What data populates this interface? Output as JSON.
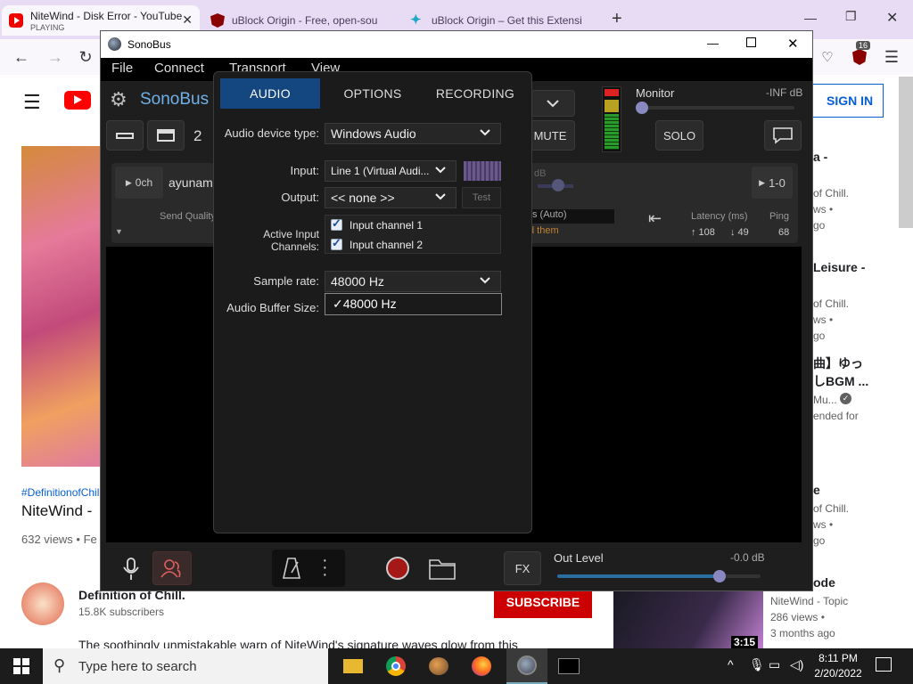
{
  "browser": {
    "tabs": [
      {
        "title": "NiteWind - Disk Error - YouTube",
        "subtitle": "PLAYING",
        "icon": "youtube-icon"
      },
      {
        "title": "uBlock Origin - Free, open-sou",
        "icon": "ublock-icon"
      },
      {
        "title": "uBlock Origin – Get this Extensi",
        "icon": "mozilla-addons-icon"
      }
    ],
    "new_tab": "+",
    "extension_badge": "16"
  },
  "youtube": {
    "sign_in": "SIGN IN",
    "hashtag": "#DefinitionofChil",
    "video_title": "NiteWind -",
    "views": "632 views • Fe",
    "channel_name": "Definition of Chill.",
    "subscribers": "15.8K subscribers",
    "subscribe": "SUBSCRIBE",
    "description": "The soothingly unmistakable warp of NiteWind's signature waves glow from this",
    "sidebar": [
      {
        "line1": "a -",
        "line2": "of Chill.",
        "line3": "ws •",
        "line4": "go"
      },
      {
        "line1": "Leisure -",
        "line2": "of Chill.",
        "line3": "ws •",
        "line4": "go"
      },
      {
        "line1": "曲】ゆっ",
        "line2": "しBGM ...",
        "line3": "Mu...",
        "line4": "ended for"
      },
      {
        "line1": "e",
        "line2": "of Chill.",
        "line3": "ws •",
        "line4": "go"
      }
    ],
    "last_card": {
      "title": "ode",
      "channel": "NiteWind - Topic",
      "views": "286 views •",
      "age": "3 months ago",
      "duration": "3:15"
    }
  },
  "sonobus": {
    "window_title": "SonoBus",
    "menu": [
      "File",
      "Connect",
      "Transport",
      "View"
    ],
    "app_name": "SonoBus",
    "layout_num": "2",
    "mute": "MUTE",
    "monitor_label": "Monitor",
    "monitor_value": "-INF dB",
    "solo": "SOLO",
    "peer": {
      "channels": "0ch",
      "name": "ayunam",
      "db": "dB",
      "routing": "1-0",
      "send_quality": "Send Quality",
      "auto": "s (Auto)",
      "send_them": "d them",
      "latency_label": "Latency (ms)",
      "ping_label": "Ping",
      "latency_up": "↑ 108",
      "latency_down": "↓ 49",
      "ping": "68"
    },
    "fx": "FX",
    "out_level_label": "Out Level",
    "out_level_value": "-0.0 dB",
    "out_level_fraction": 0.8
  },
  "dialog": {
    "tabs": [
      "AUDIO",
      "OPTIONS",
      "RECORDING"
    ],
    "device_type_label": "Audio device type:",
    "device_type_value": "Windows Audio",
    "input_label": "Input:",
    "input_value": "Line 1 (Virtual Audi...",
    "output_label": "Output:",
    "output_value": "<< none >>",
    "test_button": "Test",
    "channels_label": "Active Input Channels:",
    "channels": [
      "Input channel 1",
      "Input channel 2"
    ],
    "sample_rate_label": "Sample rate:",
    "sample_rate_value": "48000 Hz",
    "buffer_label": "Audio Buffer Size:",
    "dropdown_option": "✓48000 Hz"
  },
  "taskbar": {
    "search_placeholder": "Type here to search",
    "time": "8:11 PM",
    "date": "2/20/2022"
  }
}
